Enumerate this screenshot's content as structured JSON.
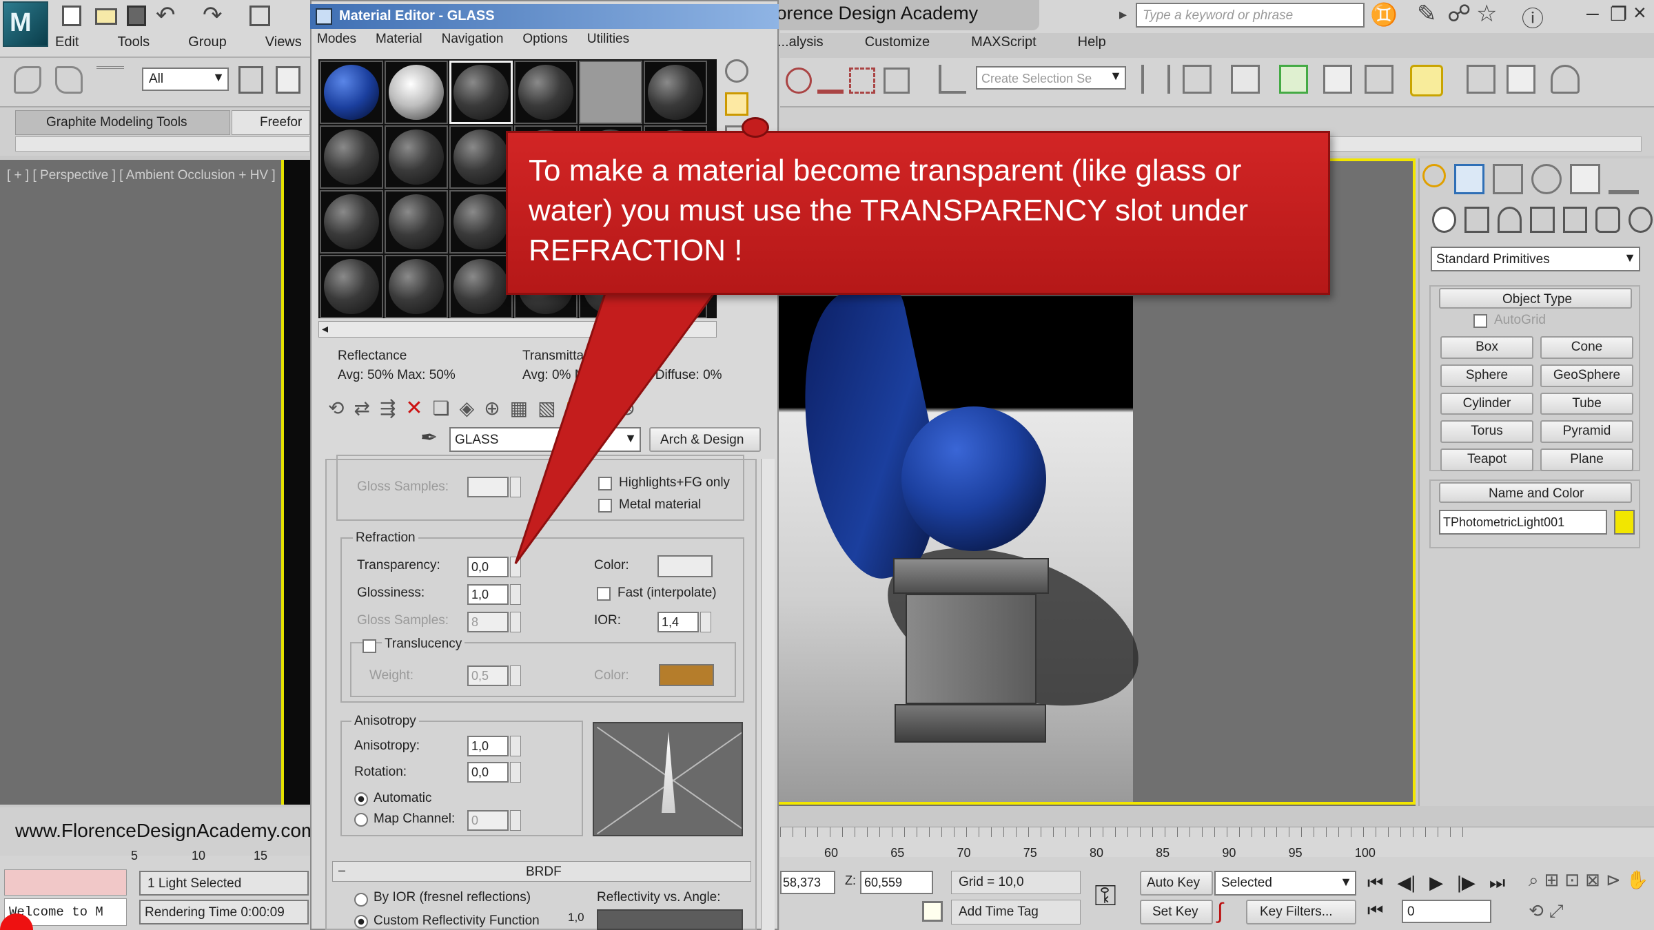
{
  "app": {
    "title": "Florence Design Academy",
    "search_placeholder": "Type a keyword or phrase",
    "menu_left": [
      "Edit",
      "Tools",
      "Group",
      "Views"
    ],
    "menu_right": [
      "...alysis",
      "Customize",
      "MAXScript",
      "Help"
    ],
    "selection_filter": "All",
    "named_selection_placeholder": "Create Selection Se",
    "ribbon_tabs": [
      "Graphite Modeling Tools",
      "Freefor"
    ],
    "viewport_label": "[ + ] [ Perspective ] [ Ambient Occlusion + HV ]"
  },
  "material_editor": {
    "title": "Material Editor - GLASS",
    "menu": [
      "Modes",
      "Material",
      "Navigation",
      "Options",
      "Utilities"
    ],
    "reflectance_label": "Reflectance",
    "reflectance_value": "Avg:  50% Max:  50%",
    "transmittance_label": "Transmittance",
    "transmittance_value": "Avg:   0% Max",
    "diffuse_value": "0% Diffuse:   0%",
    "material_name": "GLASS",
    "material_type": "Arch & Design",
    "gloss_samples_label": "Gloss Samples:",
    "highlights_label": "Highlights+FG only",
    "metal_label": "Metal material",
    "refraction": {
      "title": "Refraction",
      "transparency_label": "Transparency:",
      "transparency_value": "0,0",
      "glossiness_label": "Glossiness:",
      "glossiness_value": "1,0",
      "gloss_samples_label": "Gloss Samples:",
      "gloss_samples_value": "8",
      "color_label": "Color:",
      "fast_label": "Fast (interpolate)",
      "ior_label": "IOR:",
      "ior_value": "1,4",
      "translucency_label": "Translucency",
      "weight_label": "Weight:",
      "weight_value": "0,5",
      "trans_color_label": "Color:"
    },
    "anisotropy": {
      "title": "Anisotropy",
      "anisotropy_label": "Anisotropy:",
      "anisotropy_value": "1,0",
      "rotation_label": "Rotation:",
      "rotation_value": "0,0",
      "automatic_label": "Automatic",
      "map_channel_label": "Map Channel:",
      "map_channel_value": "0"
    },
    "brdf": {
      "title": "BRDF",
      "by_ior_label": "By IOR (fresnel reflections)",
      "custom_label": "Custom Reflectivity Function",
      "curve_label": "Reflectivity vs. Angle:",
      "curve_value": "1,0"
    }
  },
  "callout": {
    "text": "To make a material become transparent (like glass or water) you must use the TRANSPARENCY slot under REFRACTION !"
  },
  "command_panel": {
    "dropdown": "Standard Primitives",
    "object_type_title": "Object Type",
    "autogrid_label": "AutoGrid",
    "buttons": [
      "Box",
      "Cone",
      "Sphere",
      "GeoSphere",
      "Cylinder",
      "Tube",
      "Torus",
      "Pyramid",
      "Teapot",
      "Plane"
    ],
    "name_color_title": "Name and Color",
    "object_name": "TPhotometricLight001"
  },
  "status": {
    "watermark": "www.FlorenceDesignAcademy.com",
    "selection_status": "1 Light Selected",
    "rendering_time": "Rendering Time  0:00:09",
    "listener": "Welcome to M",
    "coord_x": "58,373",
    "coord_z_label": "Z:",
    "coord_z": "60,559",
    "grid": "Grid = 10,0",
    "add_time_tag": "Add Time Tag",
    "auto_key": "Auto Key",
    "set_key": "Set Key",
    "key_mode": "Selected",
    "key_filters": "Key Filters...",
    "frame": "0"
  },
  "timeline": {
    "ticks": [
      "60",
      "65",
      "70",
      "75",
      "80",
      "85",
      "90",
      "95",
      "100"
    ],
    "left_ticks": [
      "5",
      "10",
      "15"
    ]
  },
  "colors": {
    "callout": "#c41d1d",
    "accent_yellow": "#f2e600",
    "glass_color_swatch": "#ececec",
    "translucency_swatch": "#b57d2b",
    "sphere_blue": "#1b3f9e"
  }
}
